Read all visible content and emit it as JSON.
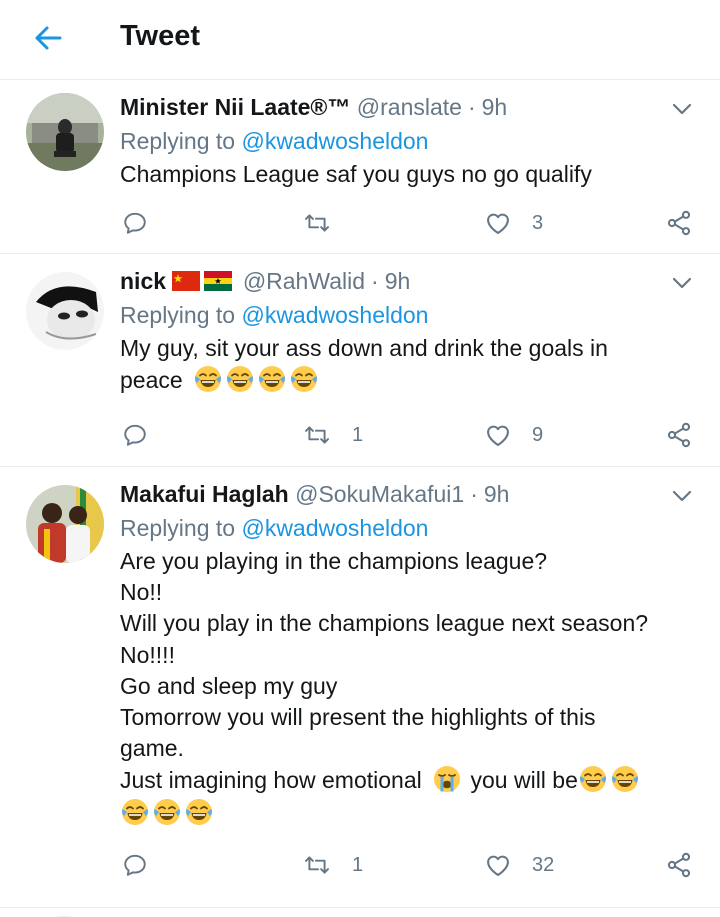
{
  "header": {
    "title": "Tweet"
  },
  "reply_prefix": "Replying to",
  "replies": [
    {
      "name": "Minister Nii Laate®™",
      "handle": "@ranslate",
      "time": "9h",
      "replying_to": "@kwadwosheldon",
      "lines": [
        "Champions League saf you guys no go qualify"
      ],
      "retweets": "",
      "likes": "3"
    },
    {
      "name": "nick",
      "flags": [
        "china-flag",
        "ghana-flag"
      ],
      "handle": "@RahWalid",
      "time": "9h",
      "replying_to": "@kwadwosheldon",
      "lines": [
        "My guy, sit your ass down and drink the goals in",
        "peace"
      ],
      "line2_emojis": [
        "face-with-tears-of-joy",
        "face-with-tears-of-joy",
        "face-with-tears-of-joy",
        "face-with-tears-of-joy"
      ],
      "retweets": "1",
      "likes": "9"
    },
    {
      "name": "Makafui Haglah",
      "handle": "@SokuMakafui1",
      "time": "9h",
      "replying_to": "@kwadwosheldon",
      "lines": [
        "Are you playing in the champions league?",
        "No!!",
        "Will you play in the champions league next season?",
        "No!!!!",
        "Go and sleep my guy",
        "Tomorrow you will present the highlights of this",
        "game.",
        "Just imagining how emotional",
        "you will be"
      ],
      "emotional_emoji": "loudly-crying-face",
      "trailing_emojis": [
        "face-with-tears-of-joy",
        "face-with-tears-of-joy",
        "face-with-tears-of-joy",
        "face-with-tears-of-joy",
        "face-with-tears-of-joy"
      ],
      "retweets": "1",
      "likes": "32"
    }
  ],
  "colors": {
    "link": "#1b95e0",
    "secondary_text": "#657786",
    "primary_text": "#14171a",
    "divider": "#e6ecf0"
  },
  "icons": [
    "back-arrow-icon",
    "chevron-down-icon",
    "reply-icon",
    "retweet-icon",
    "like-icon",
    "share-icon"
  ]
}
